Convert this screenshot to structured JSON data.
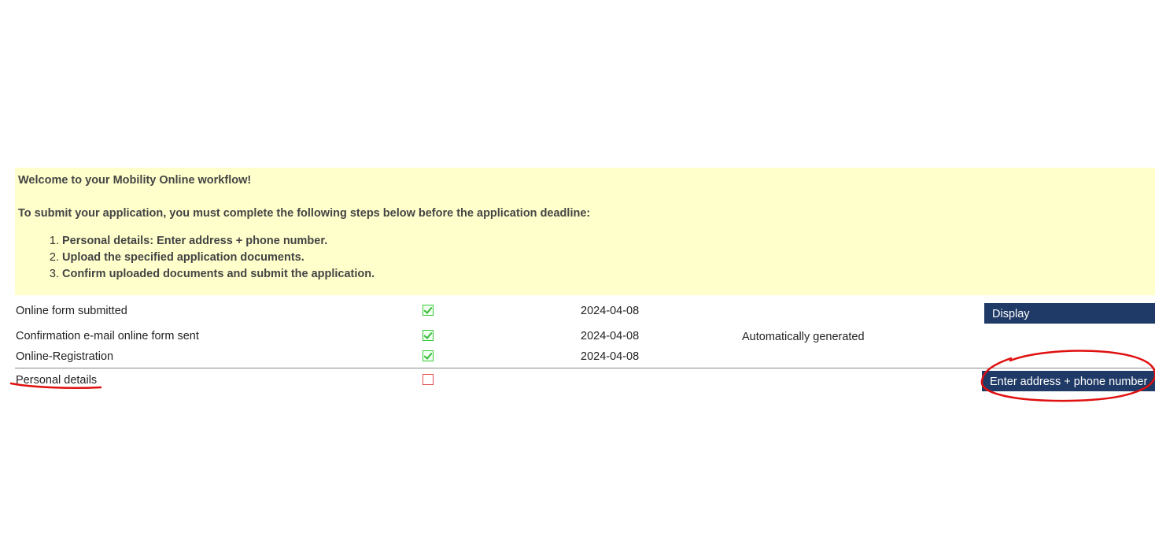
{
  "info": {
    "welcome": "Welcome to your Mobility Online workflow!",
    "intro": "To submit your application, you must complete the following steps below before the application deadline:",
    "steps": [
      "Personal details: Enter address + phone number.",
      "Upload the specified application documents.",
      "Confirm uploaded documents and submit the application."
    ]
  },
  "workflow": {
    "rows": [
      {
        "label": "Online form submitted",
        "status": "done",
        "date": "2024-04-08",
        "note": "",
        "button": "Display"
      },
      {
        "label": "Confirmation e-mail online form sent",
        "status": "done",
        "date": "2024-04-08",
        "note": "Automatically generated",
        "button": ""
      },
      {
        "label": "Online-Registration",
        "status": "done",
        "date": "2024-04-08",
        "note": "",
        "button": ""
      },
      {
        "label": "Personal details",
        "status": "pending",
        "date": "",
        "note": "",
        "button": "Enter address + phone number"
      }
    ]
  },
  "colors": {
    "info_background": "#ffffcc",
    "button_background": "#1f3a66",
    "done_check": "#33bb33",
    "pending_box": "#e05050",
    "annotation": "#e01010"
  },
  "icons": {
    "done": "checkbox-checked-icon",
    "pending": "checkbox-empty-icon"
  }
}
